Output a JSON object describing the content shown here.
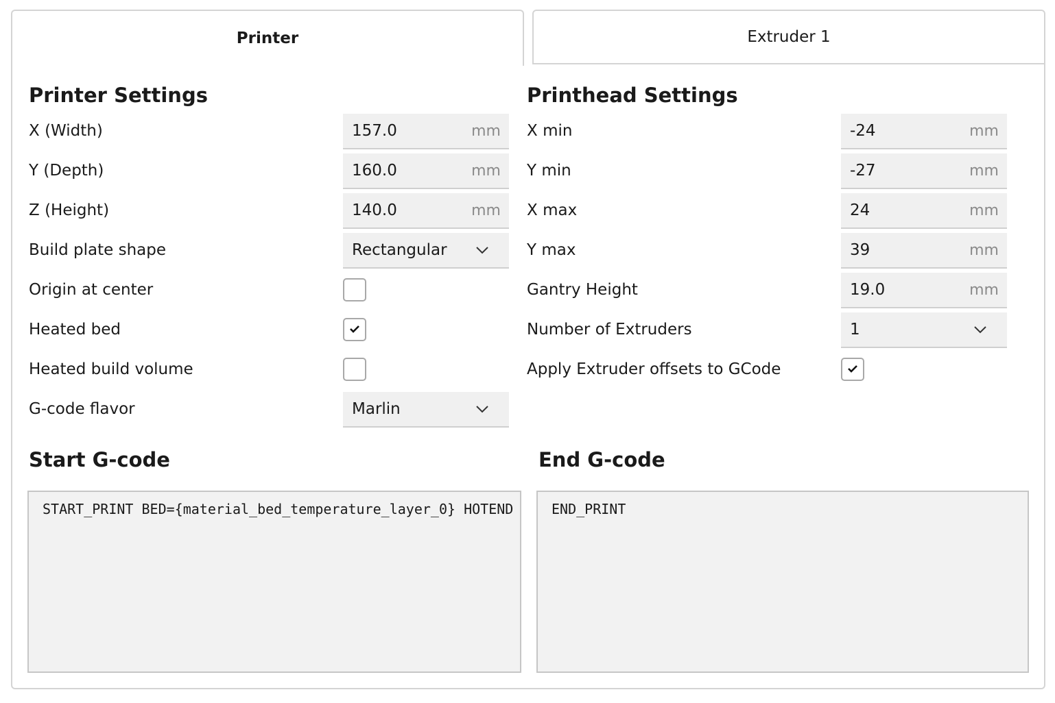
{
  "tabs": {
    "printer": "Printer",
    "extruder": "Extruder 1"
  },
  "printer_settings": {
    "title": "Printer Settings",
    "x_width": {
      "label": "X (Width)",
      "value": "157.0",
      "unit": "mm"
    },
    "y_depth": {
      "label": "Y (Depth)",
      "value": "160.0",
      "unit": "mm"
    },
    "z_height": {
      "label": "Z (Height)",
      "value": "140.0",
      "unit": "mm"
    },
    "build_plate_shape": {
      "label": "Build plate shape",
      "value": "Rectangular"
    },
    "origin_at_center": {
      "label": "Origin at center",
      "checked": false
    },
    "heated_bed": {
      "label": "Heated bed",
      "checked": true
    },
    "heated_build_volume": {
      "label": "Heated build volume",
      "checked": false
    },
    "gcode_flavor": {
      "label": "G-code flavor",
      "value": "Marlin"
    }
  },
  "printhead_settings": {
    "title": "Printhead Settings",
    "x_min": {
      "label": "X min",
      "value": "-24",
      "unit": "mm"
    },
    "y_min": {
      "label": "Y min",
      "value": "-27",
      "unit": "mm"
    },
    "x_max": {
      "label": "X max",
      "value": "24",
      "unit": "mm"
    },
    "y_max": {
      "label": "Y max",
      "value": "39",
      "unit": "mm"
    },
    "gantry_height": {
      "label": "Gantry Height",
      "value": "19.0",
      "unit": "mm"
    },
    "number_of_extruders": {
      "label": "Number of Extruders",
      "value": "1"
    },
    "apply_extruder_offsets": {
      "label": "Apply Extruder offsets to GCode",
      "checked": true
    }
  },
  "start_gcode": {
    "title": "Start G-code",
    "content": "START_PRINT BED={material_bed_temperature_layer_0} HOTEND"
  },
  "end_gcode": {
    "title": "End G-code",
    "content": "END_PRINT"
  },
  "icons": {
    "dropdown": "chevron-down-icon",
    "check": "checkmark-icon"
  }
}
